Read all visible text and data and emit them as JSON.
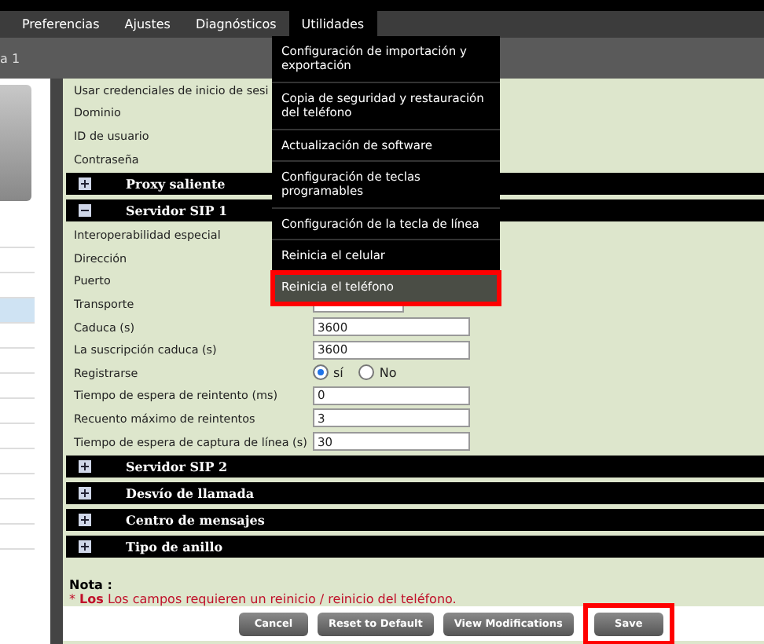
{
  "tabs": [
    {
      "label": "Preferencias",
      "selected": false
    },
    {
      "label": "Ajustes",
      "selected": false
    },
    {
      "label": "Diagnósticos",
      "selected": false
    },
    {
      "label": "Utilidades",
      "selected": true
    }
  ],
  "breadcrumb": "a 1",
  "menu": [
    {
      "label": "Configuración de importación y exportación",
      "selected": false,
      "highlighted": false
    },
    {
      "label": "Copia de seguridad y restauración del teléfono",
      "selected": false,
      "highlighted": false
    },
    {
      "label": "Actualización de software",
      "selected": false,
      "highlighted": false
    },
    {
      "label": "Configuración de teclas programables",
      "selected": false,
      "highlighted": false
    },
    {
      "label": "Configuración de la tecla de línea",
      "selected": false,
      "highlighted": false
    },
    {
      "label": "Reinicia el celular",
      "selected": false,
      "highlighted": false
    },
    {
      "label": "Reinicia el teléfono",
      "selected": true,
      "highlighted": true
    }
  ],
  "form": [
    {
      "kind": "label",
      "label": "Usar credenciales de inicio de sesi"
    },
    {
      "kind": "label",
      "label": "Dominio"
    },
    {
      "kind": "label",
      "label": "ID de usuario"
    },
    {
      "kind": "label",
      "label": "Contraseña"
    },
    {
      "kind": "section",
      "label": "Proxy saliente",
      "expanded": false
    },
    {
      "kind": "section",
      "label": "Servidor SIP 1",
      "expanded": true
    },
    {
      "kind": "label",
      "label": "Interoperabilidad especial"
    },
    {
      "kind": "label",
      "label": "Dirección"
    },
    {
      "kind": "label",
      "label": "Puerto"
    },
    {
      "kind": "select",
      "label": "Transporte"
    },
    {
      "kind": "input",
      "label": "Caduca (s)",
      "value": "3600"
    },
    {
      "kind": "input",
      "label": "La suscripción caduca (s)",
      "value": "3600"
    },
    {
      "kind": "radio",
      "label": "Registrarse",
      "options": [
        {
          "label": "sí",
          "selected": true
        },
        {
          "label": "No",
          "selected": false
        }
      ]
    },
    {
      "kind": "input",
      "label": "Tiempo de espera de reintento (ms)",
      "value": "0"
    },
    {
      "kind": "input",
      "label": "Recuento máximo de reintentos",
      "value": "3"
    },
    {
      "kind": "input",
      "label": "Tiempo de espera de captura de línea (s)",
      "value": "30"
    },
    {
      "kind": "section",
      "label": "Servidor SIP 2",
      "expanded": false
    },
    {
      "kind": "section",
      "label": "Desvío de llamada",
      "expanded": false
    },
    {
      "kind": "section",
      "label": "Centro de mensajes",
      "expanded": false
    },
    {
      "kind": "section",
      "label": "Tipo de anillo",
      "expanded": false
    }
  ],
  "note": {
    "title": "Nota :",
    "text": "* **Los** Los campos requieren un reinicio / reinicio del teléfono."
  },
  "buttons": [
    {
      "label": "Cancel",
      "highlighted": false
    },
    {
      "label": "Reset to Default",
      "highlighted": false
    },
    {
      "label": "View Modifications",
      "highlighted": false
    },
    {
      "label": "Save",
      "highlighted": true
    }
  ]
}
